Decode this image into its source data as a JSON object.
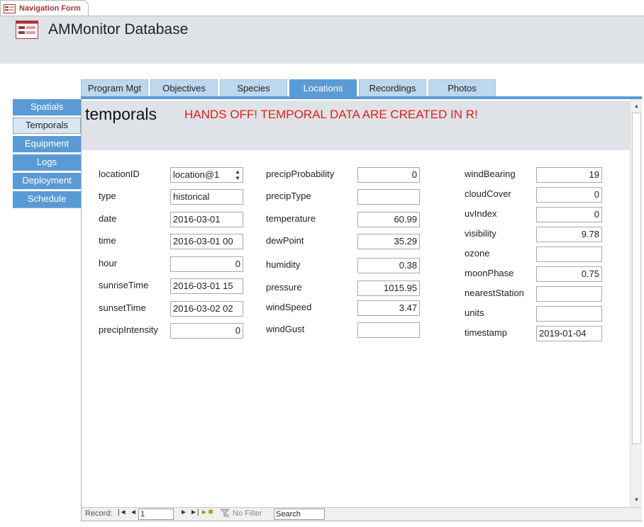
{
  "document_tab": {
    "title": "Navigation Form",
    "icon": "form-icon"
  },
  "header": {
    "title": "AMMonitor Database",
    "icon": "form-icon"
  },
  "top_tabs": [
    {
      "label": "Program Mgt",
      "active": false
    },
    {
      "label": "Objectives",
      "active": false
    },
    {
      "label": "Species",
      "active": false
    },
    {
      "label": "Locations",
      "active": true
    },
    {
      "label": "Recordings",
      "active": false
    },
    {
      "label": "Photos",
      "active": false
    }
  ],
  "left_nav": [
    {
      "label": "Spatials",
      "active": false
    },
    {
      "label": "Temporals",
      "active": true
    },
    {
      "label": "Equipment",
      "active": false
    },
    {
      "label": "Logs",
      "active": false
    },
    {
      "label": "Deployment",
      "active": false
    },
    {
      "label": "Schedule",
      "active": false
    }
  ],
  "subform": {
    "title": "temporals",
    "warning": "HANDS OFF!  TEMPORAL DATA ARE CREATED IN R!"
  },
  "fields": {
    "col1": [
      {
        "label": "locationID",
        "value": "location@1"
      },
      {
        "label": "type",
        "value": "historical"
      },
      {
        "label": "date",
        "value": "2016-03-01"
      },
      {
        "label": "time",
        "value": "2016-03-01 00"
      },
      {
        "label": "hour",
        "value": "0"
      },
      {
        "label": "sunriseTime",
        "value": "2016-03-01 15"
      },
      {
        "label": "sunsetTime",
        "value": "2016-03-02 02"
      },
      {
        "label": "precipIntensity",
        "value": "0"
      }
    ],
    "col2": [
      {
        "label": "precipProbability",
        "value": "0"
      },
      {
        "label": "precipType",
        "value": ""
      },
      {
        "label": "temperature",
        "value": "60.99"
      },
      {
        "label": "dewPoint",
        "value": "35.29"
      },
      {
        "label": "humidity",
        "value": "0.38"
      },
      {
        "label": "pressure",
        "value": "1015.95"
      },
      {
        "label": "windSpeed",
        "value": "3.47"
      },
      {
        "label": "windGust",
        "value": ""
      }
    ],
    "col3": [
      {
        "label": "windBearing",
        "value": "19"
      },
      {
        "label": "cloudCover",
        "value": "0"
      },
      {
        "label": "uvIndex",
        "value": "0"
      },
      {
        "label": "visibility",
        "value": "9.78"
      },
      {
        "label": "ozone",
        "value": ""
      },
      {
        "label": "moonPhase",
        "value": "0.75"
      },
      {
        "label": "nearestStation",
        "value": ""
      },
      {
        "label": "units",
        "value": ""
      },
      {
        "label": "timestamp",
        "value": "2019-01-04"
      }
    ]
  },
  "record_bar": {
    "label": "Record:",
    "current": "1",
    "filter_label": "No Filter",
    "search_label": "Search"
  },
  "colors": {
    "tab_active": "#5b9bd5",
    "tab_inactive": "#bdd7ee",
    "header_bg": "#dfe3e8",
    "warning": "#e0201c",
    "doc_tab_title": "#a4373a"
  }
}
